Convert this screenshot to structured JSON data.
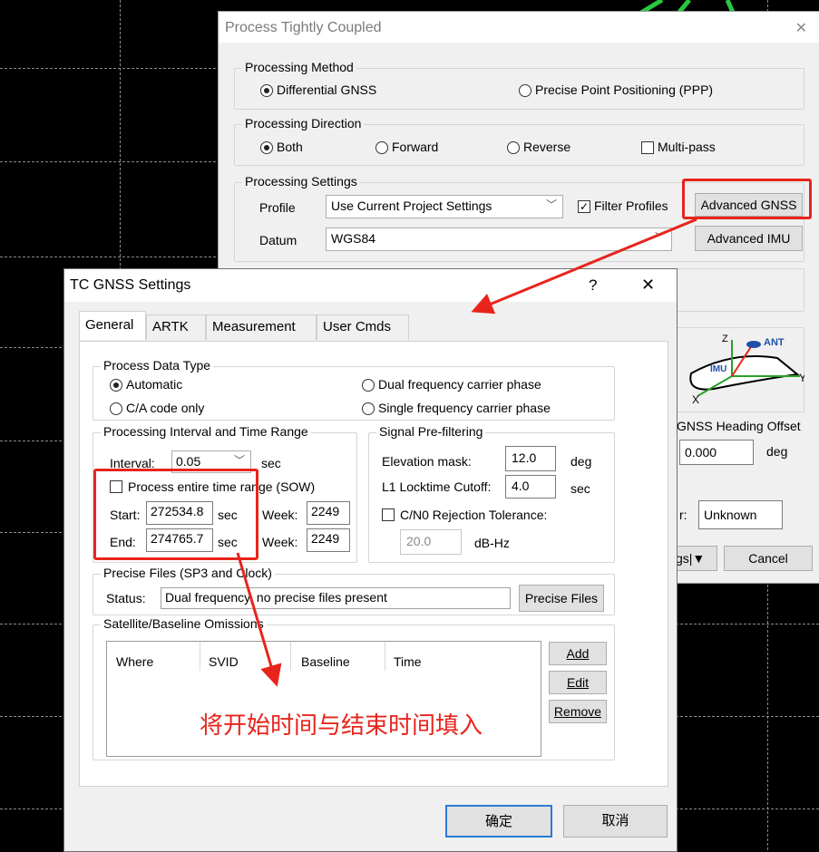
{
  "background": {
    "color": "#000000",
    "grid_color": "#8a8a8a"
  },
  "process_window": {
    "title": "Process Tightly Coupled",
    "close_glyph": "✕",
    "method": {
      "label": "Processing Method",
      "options": [
        "Differential GNSS",
        "Precise Point Positioning (PPP)"
      ],
      "selected": "Differential GNSS"
    },
    "direction": {
      "label": "Processing Direction",
      "options": [
        "Both",
        "Forward",
        "Reverse"
      ],
      "selected": "Both",
      "multipass_label": "Multi-pass",
      "multipass_checked": false
    },
    "settings": {
      "label": "Processing Settings",
      "profile_label": "Profile",
      "profile_value": "Use Current Project Settings",
      "filter_profiles_label": "Filter Profiles",
      "filter_profiles_checked": true,
      "advanced_gnss": "Advanced GNSS",
      "datum_label": "Datum",
      "datum_value": "WGS84",
      "advanced_imu": "Advanced IMU"
    },
    "diagram": {
      "z": "Z",
      "ant": "ANT",
      "imu": "IMU",
      "y": "Y",
      "x": "X"
    },
    "heading_offset": {
      "label": "GNSS Heading Offset",
      "value": "0.000",
      "unit": "deg"
    },
    "unknown_label": "r:",
    "unknown_value": "Unknown",
    "settings_btn": "gs",
    "cancel": "Cancel"
  },
  "tc_dialog": {
    "title": "TC GNSS Settings",
    "help_glyph": "?",
    "close_glyph": "✕",
    "tabs": [
      "General",
      "ARTK",
      "Measurement",
      "User Cmds"
    ],
    "active_tab": "General",
    "data_type": {
      "label": "Process Data Type",
      "automatic": "Automatic",
      "ca_only": "C/A code only",
      "dual": "Dual frequency carrier phase",
      "single": "Single frequency carrier phase",
      "selected": "Automatic"
    },
    "interval_group": {
      "label": "Processing Interval and Time Range",
      "interval_label": "Interval:",
      "interval_value": "0.05",
      "interval_unit": "sec",
      "entire_range_label": "Process entire time range (SOW)",
      "entire_range_checked": false,
      "start_label": "Start:",
      "start_value": "272534.8",
      "start_unit": "sec",
      "start_week_label": "Week:",
      "start_week": "2249",
      "end_label": "End:",
      "end_value": "274765.7",
      "end_unit": "sec",
      "end_week_label": "Week:",
      "end_week": "2249"
    },
    "signal_group": {
      "label": "Signal Pre-filtering",
      "elevation_label": "Elevation mask:",
      "elevation_value": "12.0",
      "elevation_unit": "deg",
      "locktime_label": "L1 Locktime Cutoff:",
      "locktime_value": "4.0",
      "locktime_unit": "sec",
      "cn0_label": "C/N0 Rejection Tolerance:",
      "cn0_checked": false,
      "cn0_value": "20.0",
      "cn0_unit": "dB-Hz"
    },
    "precise_group": {
      "label": "Precise Files (SP3 and Clock)",
      "status_label": "Status:",
      "status_value": "Dual frequency, no precise files present",
      "button": "Precise Files"
    },
    "omissions_group": {
      "label": "Satellite/Baseline Omissions",
      "columns": [
        "Where",
        "SVID",
        "Baseline",
        "Time"
      ],
      "add": "Add",
      "edit": "Edit",
      "remove": "Remove"
    },
    "ok": "确定",
    "cancel": "取消"
  },
  "annotation": {
    "text": "将开始时间与结束时间填入",
    "color": "#e8241c"
  }
}
